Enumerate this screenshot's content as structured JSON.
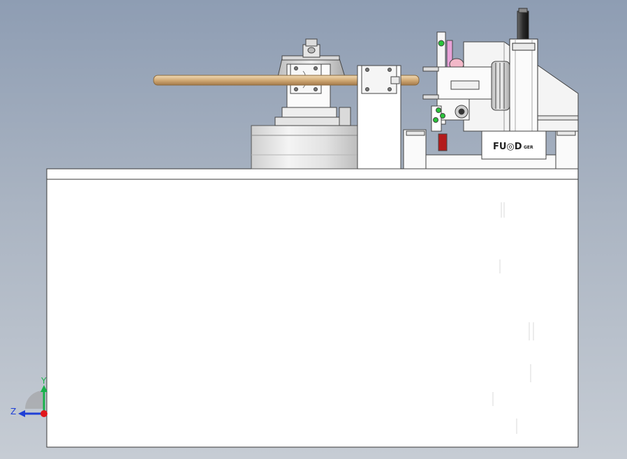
{
  "viewport": {
    "background_top": "#8e9db3",
    "background_bottom": "#c6ccd4",
    "model_fill": "#ffffff",
    "line_color": "#3a3a3a"
  },
  "machine": {
    "brand_label_main": "FU◎D",
    "brand_label_small": "GER",
    "rod_color": "#d8b88a",
    "indicator_color": "#29c43a",
    "accent_pink": "#e8a2d8",
    "accent_red": "#b31b1b"
  },
  "triad": {
    "y_label": "Y",
    "z_label": "Z",
    "y_color": "#17b24a",
    "z_color": "#1f3fd6",
    "origin_color": "#e0161b"
  }
}
